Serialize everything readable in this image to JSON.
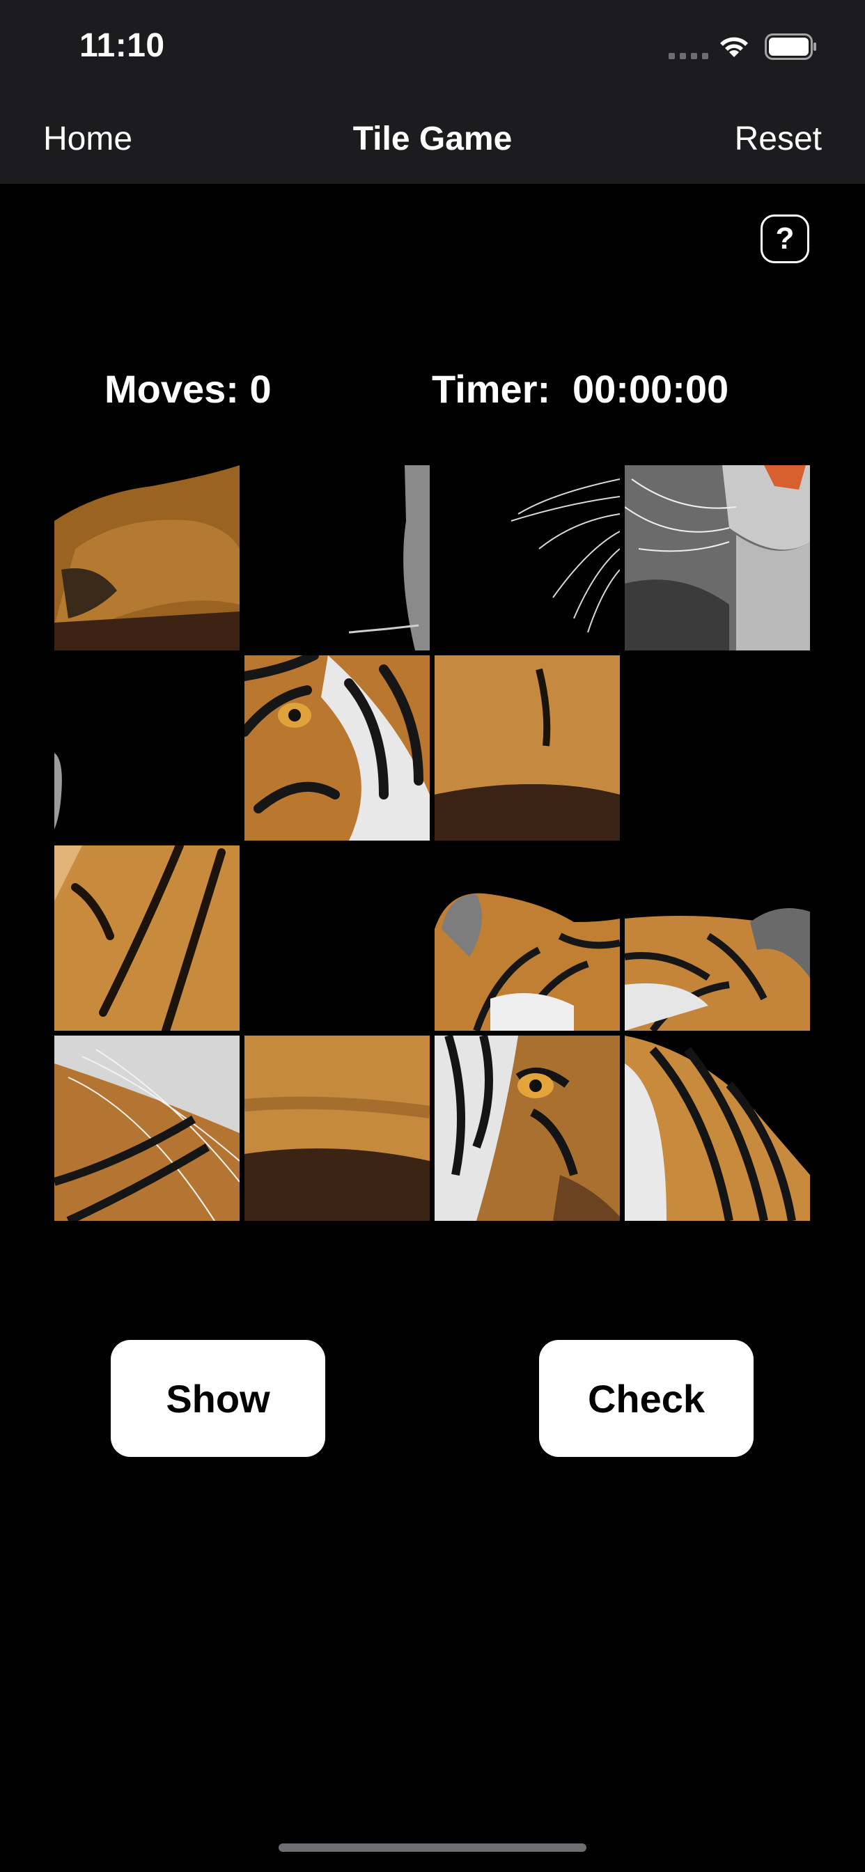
{
  "status": {
    "time": "11:10"
  },
  "nav": {
    "left": "Home",
    "title": "Tile Game",
    "right": "Reset"
  },
  "help": {
    "symbol": "?"
  },
  "stats": {
    "moves": "Moves: 0",
    "timer_label": "Timer:",
    "timer_value": "00:00:00"
  },
  "buttons": {
    "show": "Show",
    "check": "Check"
  },
  "tiles": [
    "tiger-paw",
    "dark-edge-fur",
    "whiskers-dark",
    "tiger-muzzle",
    "dark-left-edge",
    "tiger-eye-left",
    "tiger-body-fur",
    "empty-dark",
    "striped-fur",
    "empty-dark",
    "tiger-ear-left",
    "tiger-ear-right",
    "tiger-whisker-cheek",
    "tiger-back-fur",
    "tiger-face-eye",
    "tiger-shoulder-stripes"
  ]
}
